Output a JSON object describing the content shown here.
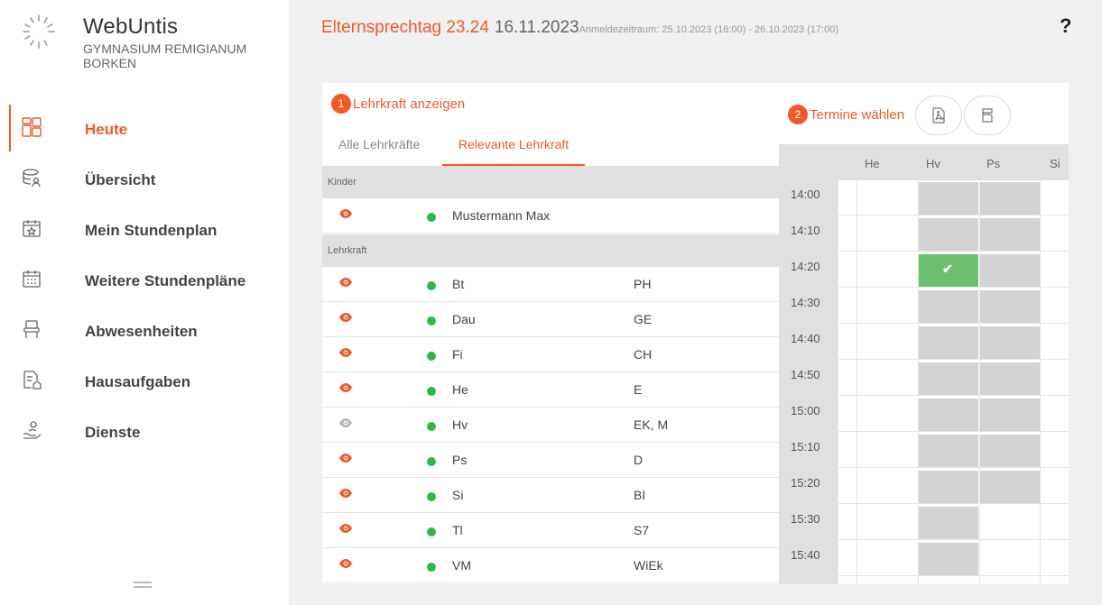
{
  "brand": {
    "name": "WebUntis",
    "school": "GYMNASIUM REMIGIANUM BORKEN"
  },
  "nav": {
    "items": [
      {
        "label": "Heute",
        "icon": "dashboard-icon",
        "active": true
      },
      {
        "label": "Übersicht",
        "icon": "overview-icon",
        "active": false
      },
      {
        "label": "Mein Stundenplan",
        "icon": "calendar-star-icon",
        "active": false
      },
      {
        "label": "Weitere Stundenpläne",
        "icon": "calendar-grid-icon",
        "active": false
      },
      {
        "label": "Abwesenheiten",
        "icon": "chair-icon",
        "active": false
      },
      {
        "label": "Hausaufgaben",
        "icon": "homework-icon",
        "active": false
      },
      {
        "label": "Dienste",
        "icon": "service-hand-icon",
        "active": false
      }
    ]
  },
  "header": {
    "title": "Elternsprechtag 23.24",
    "date": "16.11.2023",
    "period": "Anmeldezeitraum: 25.10.2023 (16:00) - 26.10.2023 (17:00)",
    "help": "?"
  },
  "teachers_panel": {
    "step_num": "1",
    "step_label": "Lehrkraft anzeigen",
    "tabs": [
      {
        "label": "Alle Lehrkräfte",
        "active": false
      },
      {
        "label": "Relevante Lehrkraft",
        "active": true
      }
    ],
    "children_header": "Kinder",
    "children": [
      {
        "name": "Mustermann Max",
        "status_color": "#2db84d"
      }
    ],
    "teachers_header": "Lehrkraft",
    "teachers": [
      {
        "name": "Bt",
        "subjects": "PH",
        "visible": true
      },
      {
        "name": "Dau",
        "subjects": "GE",
        "visible": true
      },
      {
        "name": "Fi",
        "subjects": "CH",
        "visible": true
      },
      {
        "name": "He",
        "subjects": "E",
        "visible": true
      },
      {
        "name": "Hv",
        "subjects": "EK, M",
        "visible": false
      },
      {
        "name": "Ps",
        "subjects": "D",
        "visible": true
      },
      {
        "name": "Si",
        "subjects": "BI",
        "visible": true
      },
      {
        "name": "Tl",
        "subjects": "S7",
        "visible": true
      },
      {
        "name": "VM",
        "subjects": "WiEk",
        "visible": true
      }
    ]
  },
  "schedule_panel": {
    "step_num": "2",
    "step_label": "Termine wählen",
    "columns": [
      "He",
      "Hv",
      "Ps",
      "Si"
    ],
    "times": [
      "14:00",
      "14:10",
      "14:20",
      "14:30",
      "14:40",
      "14:50",
      "15:00",
      "15:10",
      "15:20",
      "15:30",
      "15:40"
    ],
    "slots": [
      [
        "free",
        "busy",
        "busy",
        "free"
      ],
      [
        "free",
        "busy",
        "busy",
        "free"
      ],
      [
        "free",
        "booked",
        "busy",
        "free"
      ],
      [
        "free",
        "busy",
        "busy",
        "free"
      ],
      [
        "free",
        "busy",
        "busy",
        "free"
      ],
      [
        "free",
        "busy",
        "busy",
        "free"
      ],
      [
        "free",
        "busy",
        "busy",
        "free"
      ],
      [
        "free",
        "busy",
        "busy",
        "free"
      ],
      [
        "free",
        "busy",
        "busy",
        "free"
      ],
      [
        "free",
        "busy",
        "free",
        "free"
      ],
      [
        "free",
        "busy",
        "free",
        "free"
      ]
    ]
  },
  "colors": {
    "accent": "#f15a24",
    "online": "#2db84d",
    "booked": "#6cc070",
    "busy": "#d3d3d3"
  }
}
